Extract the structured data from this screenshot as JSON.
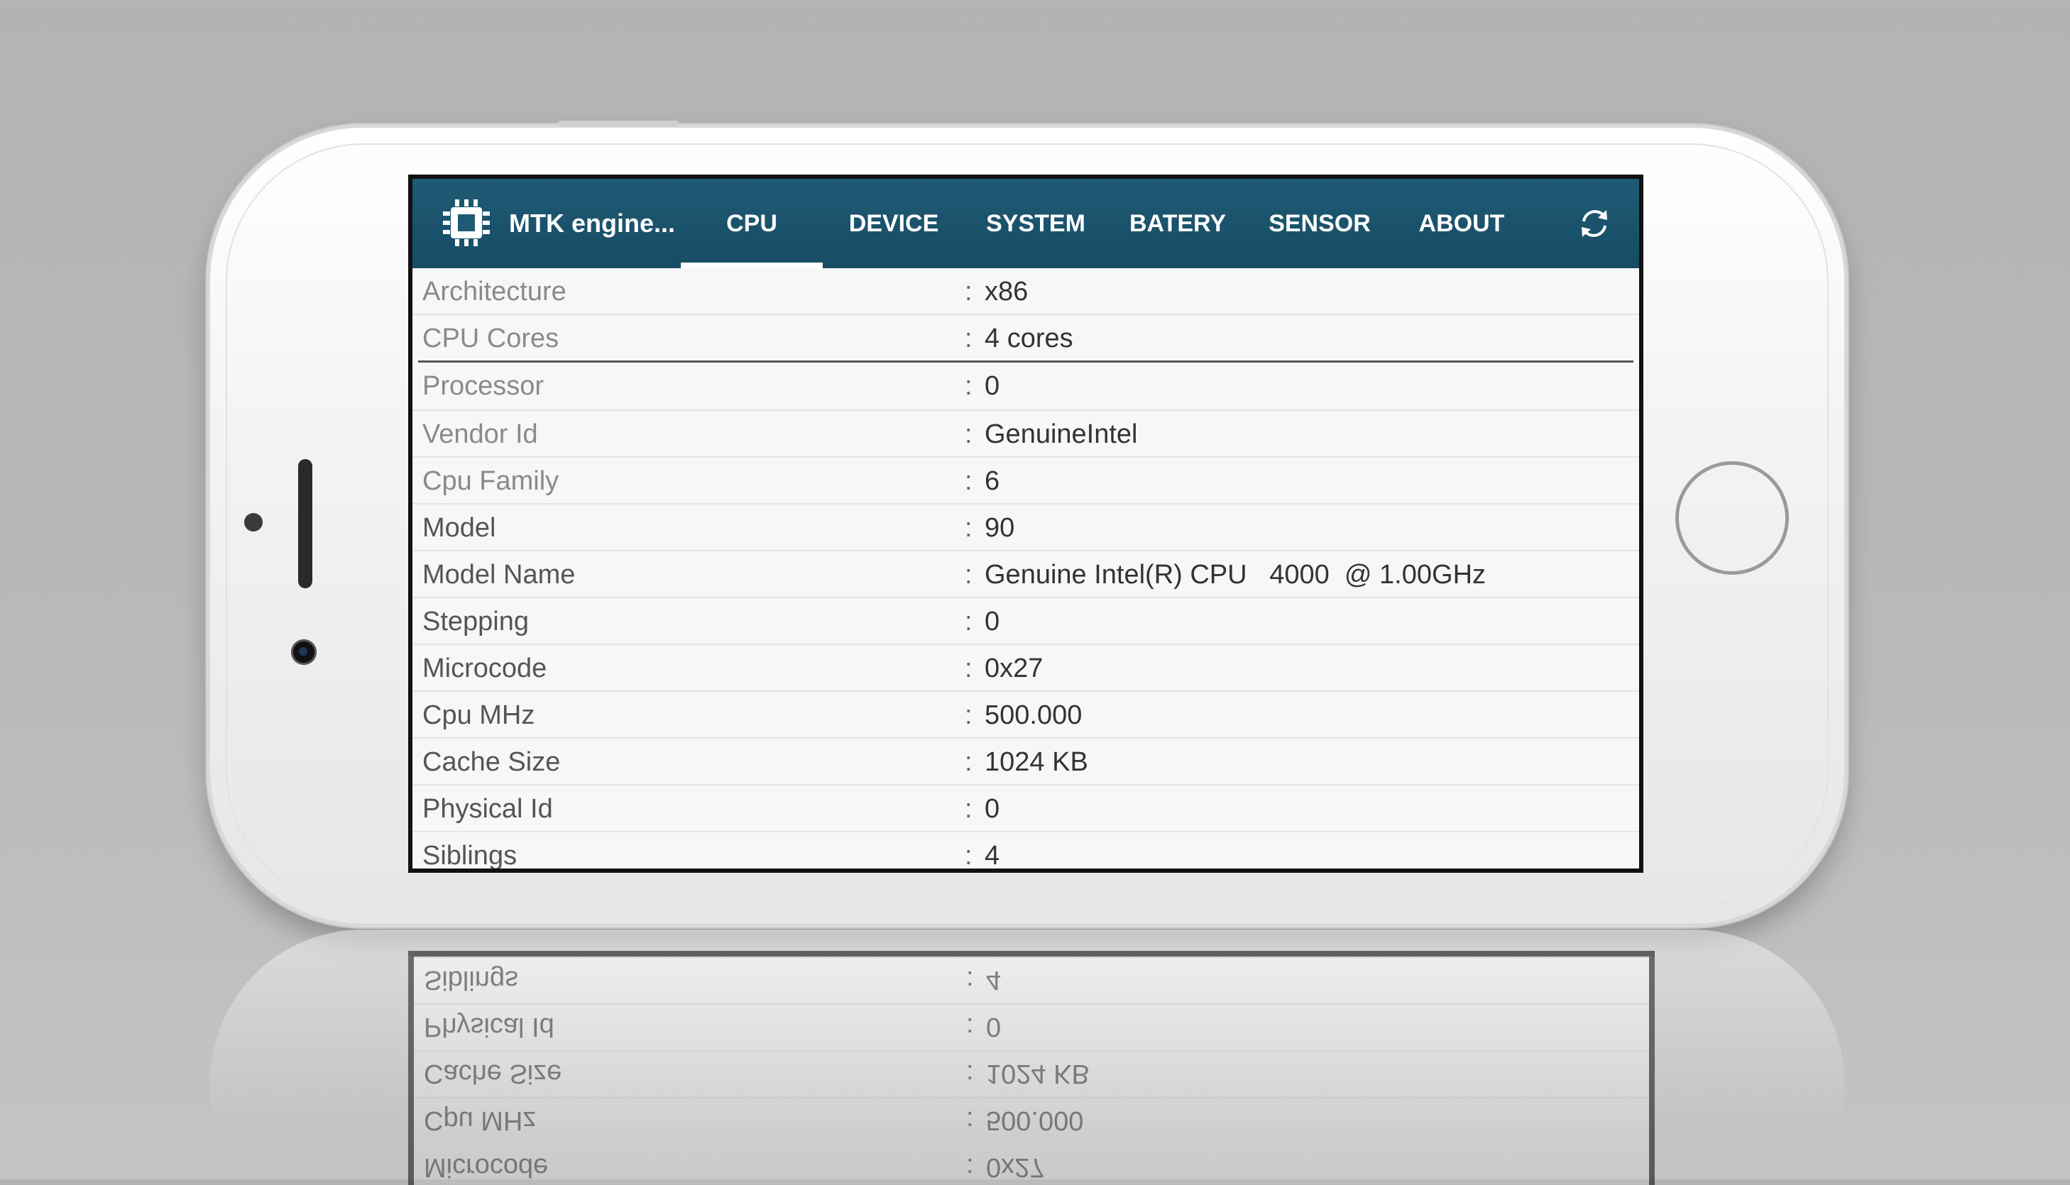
{
  "app": {
    "title": "MTK engine...",
    "logo_icon": "chip-icon",
    "refresh_icon": "refresh-icon"
  },
  "tabs": [
    {
      "label": "CPU",
      "active": true
    },
    {
      "label": "DEVICE",
      "active": false
    },
    {
      "label": "SYSTEM",
      "active": false
    },
    {
      "label": "BATERY",
      "active": false
    },
    {
      "label": "SENSOR",
      "active": false
    },
    {
      "label": "ABOUT",
      "active": false
    }
  ],
  "summary": [
    {
      "label": "Architecture",
      "value": "x86"
    },
    {
      "label": "CPU Cores",
      "value": "4 cores"
    }
  ],
  "details": [
    {
      "label": "Processor",
      "value": "0"
    },
    {
      "label": "Vendor Id",
      "value": "GenuineIntel"
    },
    {
      "label": "Cpu Family",
      "value": "6"
    },
    {
      "label": "Model",
      "value": "90"
    },
    {
      "label": "Model Name",
      "value": "Genuine Intel(R) CPU   4000  @ 1.00GHz"
    },
    {
      "label": "Stepping",
      "value": "0"
    },
    {
      "label": "Microcode",
      "value": "0x27"
    },
    {
      "label": "Cpu MHz",
      "value": "500.000"
    },
    {
      "label": "Cache Size",
      "value": "1024 KB"
    },
    {
      "label": "Physical Id",
      "value": "0"
    },
    {
      "label": "Siblings",
      "value": "4"
    }
  ],
  "reflection": [
    {
      "label": "Siblings",
      "value": "4"
    },
    {
      "label": "Physical Id",
      "value": "0"
    },
    {
      "label": "Cache Size",
      "value": "1024 KB"
    },
    {
      "label": "Cpu MHz",
      "value": "500.000"
    },
    {
      "label": "Microcode",
      "value": "0x27"
    }
  ],
  "separator": ":",
  "colors": {
    "appbar": "#1f5a74",
    "background": "#b3b3b3"
  }
}
